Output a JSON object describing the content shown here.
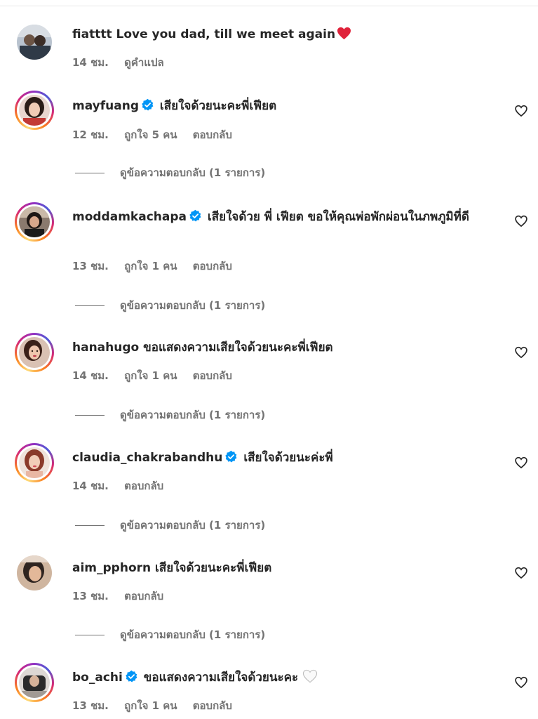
{
  "comments": [
    {
      "username": "fiatttt",
      "verified": false,
      "text": "Love you dad, till we meet again",
      "emoji": "red-heart",
      "time": "14 ชม.",
      "likes": "",
      "translate": "ดูคำแปล",
      "reply": "",
      "view_replies": "",
      "has_like_button": false
    },
    {
      "username": "mayfuang",
      "verified": true,
      "text": "เสียใจด้วยนะคะพี่เฟียต",
      "time": "12 ชม.",
      "likes": "ถูกใจ 5 คน",
      "reply": "ตอบกลับ",
      "view_replies": "ดูข้อความตอบกลับ (1 รายการ)",
      "has_like_button": true
    },
    {
      "username": "moddamkachapa",
      "verified": true,
      "text": "เสียใจด้วย พี่ เฟียต ขอให้คุณพ่อพักผ่อนในภพภูมิที่ดี",
      "time": "13 ชม.",
      "likes": "ถูกใจ 1 คน",
      "reply": "ตอบกลับ",
      "view_replies": "ดูข้อความตอบกลับ (1 รายการ)",
      "has_like_button": true
    },
    {
      "username": "hanahugo",
      "verified": false,
      "text": "ขอแสดงความเสียใจด้วยนะคะพี่เฟียต",
      "time": "14 ชม.",
      "likes": "ถูกใจ 1 คน",
      "reply": "ตอบกลับ",
      "view_replies": "ดูข้อความตอบกลับ (1 รายการ)",
      "has_like_button": true
    },
    {
      "username": "claudia_chakrabandhu",
      "verified": true,
      "text": "เสียใจด้วยนะค่ะพี่",
      "time": "14 ชม.",
      "likes": "",
      "reply": "ตอบกลับ",
      "view_replies": "ดูข้อความตอบกลับ (1 รายการ)",
      "has_like_button": true
    },
    {
      "username": "aim_pphorn",
      "verified": false,
      "text": "เสียใจด้วยนะคะพี่เฟียต",
      "time": "13 ชม.",
      "likes": "",
      "reply": "ตอบกลับ",
      "view_replies": "ดูข้อความตอบกลับ (1 รายการ)",
      "has_like_button": true
    },
    {
      "username": "bo_achi",
      "verified": true,
      "text": "ขอแสดงความเสียใจด้วยนะคะ",
      "emoji": "white-heart",
      "time": "13 ชม.",
      "likes": "ถูกใจ 1 คน",
      "reply": "ตอบกลับ",
      "view_replies": "",
      "has_like_button": true
    }
  ],
  "colors": {
    "text": "#262626",
    "secondary": "#737373",
    "verified": "#0095f6",
    "heart": "#ed4956"
  }
}
